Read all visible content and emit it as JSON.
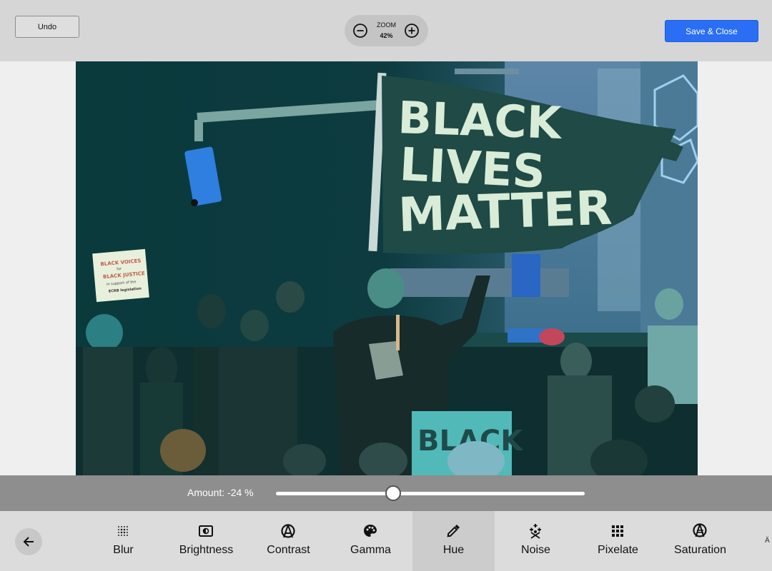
{
  "toolbar_top": {
    "undo_label": "Undo",
    "zoom_label": "ZOOM",
    "zoom_value": "42%",
    "save_label": "Save & Close"
  },
  "photo": {
    "flag_lines": [
      "BLACK",
      "LIVES",
      "MATTER"
    ],
    "sign_lines": [
      "BLACK VOICES",
      "for",
      "BLACK JUSTICE",
      "in support of the",
      "ECRB legislation"
    ]
  },
  "adjust": {
    "amount_text": "Amount: -24 %",
    "value": -24,
    "range": [
      -100,
      100
    ]
  },
  "tools": [
    {
      "label": "Blur",
      "icon": "blur-icon"
    },
    {
      "label": "Brightness",
      "icon": "brightness-icon"
    },
    {
      "label": "Contrast",
      "icon": "contrast-icon"
    },
    {
      "label": "Gamma",
      "icon": "palette-icon"
    },
    {
      "label": "Hue",
      "icon": "eyedropper-icon",
      "active": true
    },
    {
      "label": "Noise",
      "icon": "noise-icon"
    },
    {
      "label": "Pixelate",
      "icon": "grid-icon"
    },
    {
      "label": "Saturation",
      "icon": "saturation-icon"
    }
  ],
  "overflow_glyph": "Ä",
  "colors": {
    "accent": "#2a6ef5",
    "topbar": "#d6d6d6",
    "amount_bar": "#8e8e8e",
    "toolbar": "#dcdcdc",
    "active_tool": "#cccccc"
  }
}
